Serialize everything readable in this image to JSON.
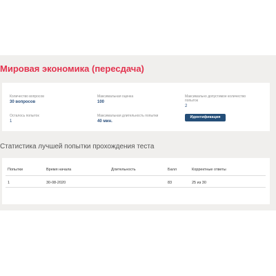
{
  "title": "Мировая экономика (пересдача)",
  "info": {
    "questions_label": "Количество вопросов",
    "questions_value": "30 вопросов",
    "attempts_left_label": "Осталось попыток",
    "attempts_left_value": "1",
    "max_score_label": "Максимальная оценка",
    "max_score_value": "100",
    "max_duration_label": "Максимальная длительность попытки",
    "max_duration_value": "40 мин.",
    "max_attempts_label": "Максимально допустимое количество попыток",
    "max_attempts_value": "2",
    "identify_button": "Идентификация"
  },
  "stats": {
    "title": "Статистика лучшей попытки прохождения теста",
    "headers": [
      "Попытки",
      "Время начала",
      "Длительность",
      "Балл",
      "Корректные ответы"
    ],
    "rows": [
      [
        "1",
        "30-08-2020",
        "",
        "83",
        "25 из 30"
      ]
    ]
  }
}
